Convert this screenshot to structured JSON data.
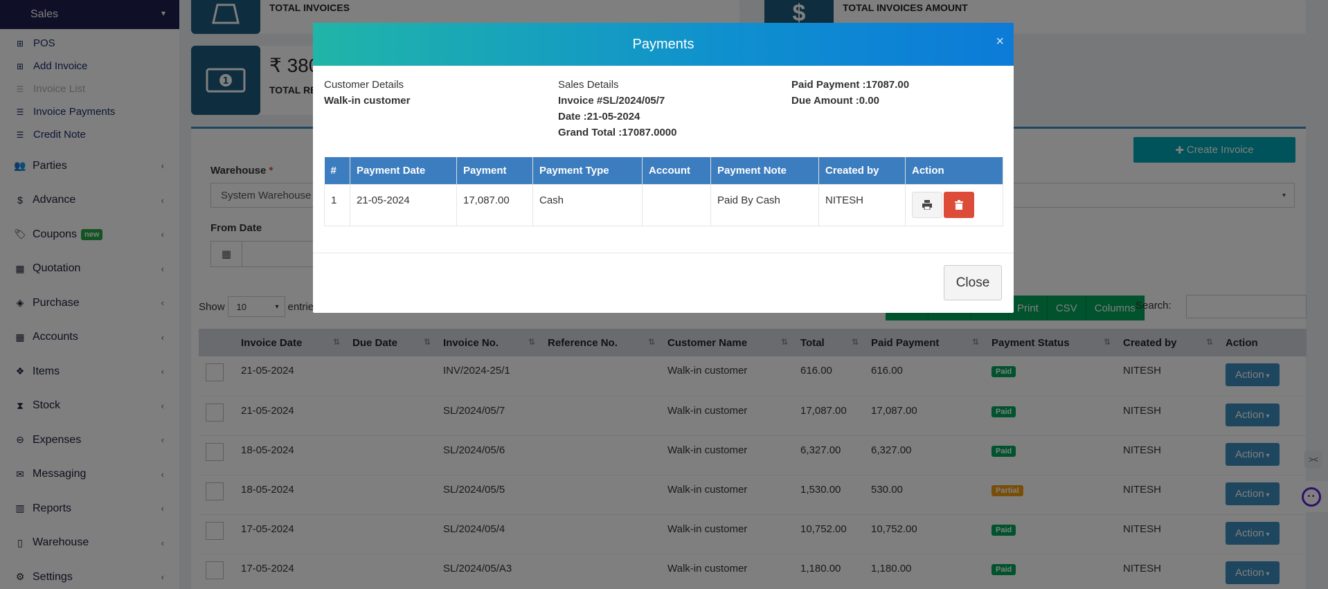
{
  "sidebar": {
    "header": "Sales",
    "sub_items": [
      {
        "label": "POS",
        "icon": "plus-square-icon",
        "muted": false
      },
      {
        "label": "Add Invoice",
        "icon": "plus-square-icon",
        "muted": false
      },
      {
        "label": "Invoice List",
        "icon": "list-icon",
        "muted": true
      },
      {
        "label": "Invoice Payments",
        "icon": "list-icon",
        "muted": false
      },
      {
        "label": "Credit Note",
        "icon": "list-icon",
        "muted": false
      }
    ],
    "menu": [
      {
        "label": "Parties",
        "icon": "users-icon"
      },
      {
        "label": "Advance",
        "icon": "dollar-icon"
      },
      {
        "label": "Coupons",
        "icon": "tags-icon",
        "badge": "new"
      },
      {
        "label": "Quotation",
        "icon": "calendar-icon"
      },
      {
        "label": "Purchase",
        "icon": "cube-icon"
      },
      {
        "label": "Accounts",
        "icon": "grid-icon"
      },
      {
        "label": "Items",
        "icon": "cubes-icon"
      },
      {
        "label": "Stock",
        "icon": "hourglass-icon"
      },
      {
        "label": "Expenses",
        "icon": "minus-circle-icon"
      },
      {
        "label": "Messaging",
        "icon": "envelope-icon"
      },
      {
        "label": "Reports",
        "icon": "bar-chart-icon"
      },
      {
        "label": "Warehouse",
        "icon": "building-icon"
      },
      {
        "label": "Settings",
        "icon": "cogs-icon"
      }
    ]
  },
  "stats": {
    "total_invoices_title": "TOTAL INVOICES",
    "total_invoices_amount_title": "TOTAL INVOICES AMOUNT",
    "received_value": "₹ 380",
    "received_title": "TOTAL RE"
  },
  "filters": {
    "create_invoice": "Create Invoice",
    "warehouse_label": "Warehouse",
    "warehouse_required": "*",
    "warehouse_value": "System Warehouse",
    "from_date_label": "From Date"
  },
  "table_controls": {
    "show": "Show",
    "entries_value": "10",
    "entries": "entrie",
    "buttons": [
      "",
      "",
      "",
      "Print",
      "CSV",
      "Columns"
    ],
    "search_label": "Search:"
  },
  "invoice_table": {
    "headers": [
      "Invoice Date",
      "Due Date",
      "Invoice No.",
      "Reference No.",
      "Customer Name",
      "Total",
      "Paid Payment",
      "Payment Status",
      "Created by",
      "Action"
    ],
    "rows": [
      {
        "date": "21-05-2024",
        "due": "",
        "no": "INV/2024-25/1",
        "ref": "",
        "customer": "Walk-in customer",
        "total": "616.00",
        "paid": "616.00",
        "status": "Paid",
        "created": "NITESH",
        "action": "Action"
      },
      {
        "date": "21-05-2024",
        "due": "",
        "no": "SL/2024/05/7",
        "ref": "",
        "customer": "Walk-in customer",
        "total": "17,087.00",
        "paid": "17,087.00",
        "status": "Paid",
        "created": "NITESH",
        "action": "Action"
      },
      {
        "date": "18-05-2024",
        "due": "",
        "no": "SL/2024/05/6",
        "ref": "",
        "customer": "Walk-in customer",
        "total": "6,327.00",
        "paid": "6,327.00",
        "status": "Paid",
        "created": "NITESH",
        "action": "Action"
      },
      {
        "date": "18-05-2024",
        "due": "",
        "no": "SL/2024/05/5",
        "ref": "",
        "customer": "Walk-in customer",
        "total": "1,530.00",
        "paid": "530.00",
        "status": "Partial",
        "created": "NITESH",
        "action": "Action"
      },
      {
        "date": "17-05-2024",
        "due": "",
        "no": "SL/2024/05/4",
        "ref": "",
        "customer": "Walk-in customer",
        "total": "10,752.00",
        "paid": "10,752.00",
        "status": "Paid",
        "created": "NITESH",
        "action": "Action"
      },
      {
        "date": "17-05-2024",
        "due": "",
        "no": "SL/2024/05/A3",
        "ref": "",
        "customer": "Walk-in customer",
        "total": "1,180.00",
        "paid": "1,180.00",
        "status": "Paid",
        "created": "NITESH",
        "action": "Action"
      }
    ]
  },
  "modal": {
    "title": "Payments",
    "close_x": "×",
    "customer_details_label": "Customer Details",
    "customer_name": "Walk-in customer",
    "sales_details_label": "Sales Details",
    "invoice": "Invoice #SL/2024/05/7",
    "date": "Date :21-05-2024",
    "grand_total": "Grand Total :17087.0000",
    "paid_payment": "Paid Payment :17087.00",
    "due_amount": "Due Amount :0.00",
    "headers": [
      "#",
      "Payment Date",
      "Payment",
      "Payment Type",
      "Account",
      "Payment Note",
      "Created by",
      "Action"
    ],
    "rows": [
      {
        "num": "1",
        "date": "21-05-2024",
        "payment": "17,087.00",
        "type": "Cash",
        "account": "",
        "note": "Paid By Cash",
        "created": "NITESH"
      }
    ],
    "close_button": "Close"
  },
  "colors": {
    "paid": "#00a65a",
    "partial": "#f39c12",
    "modal_header_start": "#20b5a8",
    "modal_header_end": "#0c7bd8"
  }
}
